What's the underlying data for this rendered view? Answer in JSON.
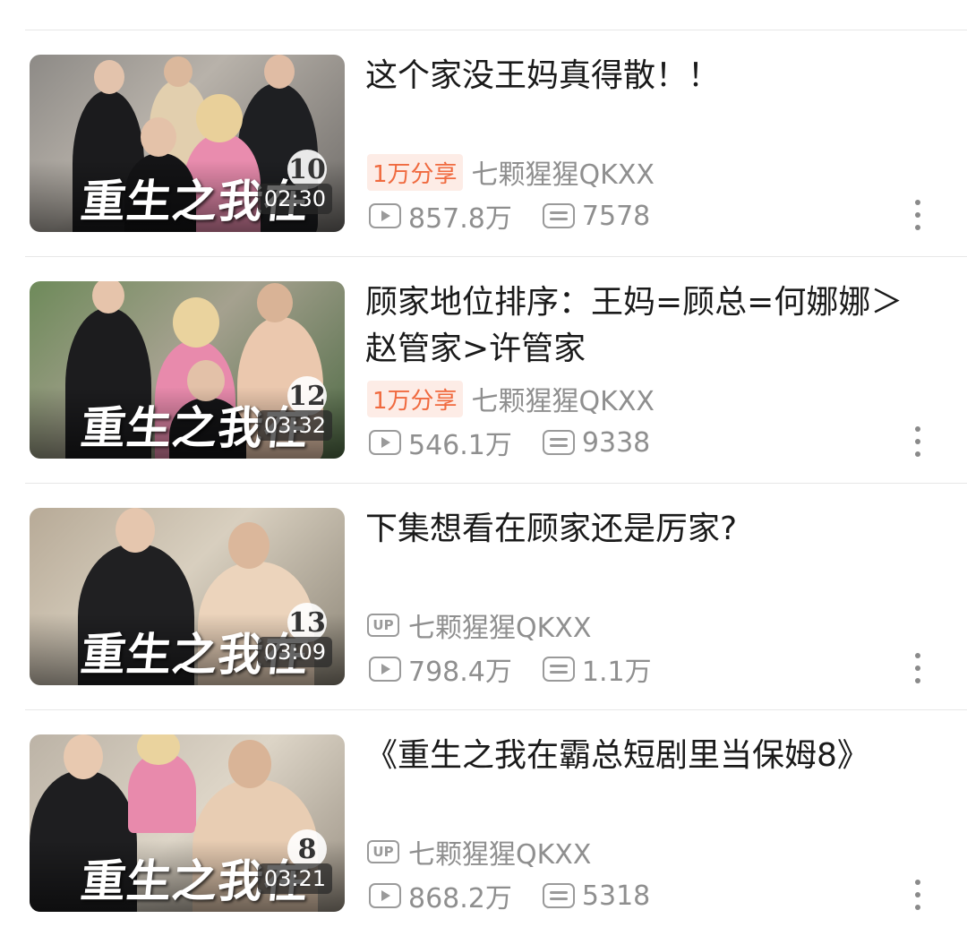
{
  "videos": [
    {
      "title": "这个家没王妈真得散！！",
      "share_tag": "1万分享",
      "uploader": "七颗猩猩QKXX",
      "views": "857.8万",
      "comments": "7578",
      "duration": "02:30",
      "thumb_overlay": "重生之我在",
      "episode_badge": "10"
    },
    {
      "title": "顾家地位排序：王妈=顾总=何娜娜＞赵管家>许管家",
      "share_tag": "1万分享",
      "uploader": "七颗猩猩QKXX",
      "views": "546.1万",
      "comments": "9338",
      "duration": "03:32",
      "thumb_overlay": "重生之我在",
      "episode_badge": "12"
    },
    {
      "title": "下集想看在顾家还是厉家?",
      "up_label": "UP",
      "uploader": "七颗猩猩QKXX",
      "views": "798.4万",
      "comments": "1.1万",
      "duration": "03:09",
      "thumb_overlay": "重生之我在",
      "episode_badge": "13"
    },
    {
      "title": "《重生之我在霸总短剧里当保姆8》",
      "up_label": "UP",
      "uploader": "七颗猩猩QKXX",
      "views": "868.2万",
      "comments": "5318",
      "duration": "03:21",
      "thumb_overlay": "重生之我在",
      "episode_badge": "8"
    }
  ],
  "colors": {
    "share_tag_text": "#f06a3f",
    "share_tag_bg": "#fdece6",
    "meta_text": "#8f8f8f",
    "title_text": "#1a1a1a"
  },
  "icons": {
    "views": "play-count-icon",
    "comments": "danmaku-count-icon",
    "more": "more-vertical-icon",
    "uploader": "up-badge-icon"
  }
}
